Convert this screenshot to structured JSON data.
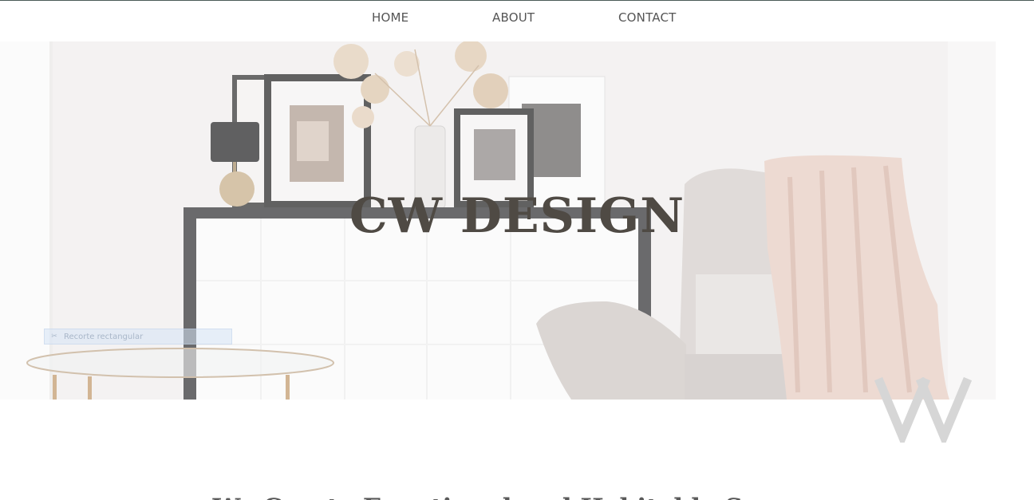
{
  "nav": {
    "home_label": "HOME",
    "about_label": "ABOUT",
    "contact_label": "CONTACT"
  },
  "hero": {
    "title": "CW DESIGN",
    "snip_badge_label": "Recorte rectangular"
  },
  "section": {
    "tagline": "We Create Functional and Habitable Spaces."
  },
  "colors": {
    "nav_text": "#555555",
    "title_text": "#4f4a44",
    "tagline_text": "#5a5a5a",
    "throw_blanket": "#e9cfc6",
    "armchair": "#d8d3d0"
  },
  "icons": {
    "scroll_decoration": "chevron-double-down-icon",
    "snip_icon": "scissors-icon"
  }
}
